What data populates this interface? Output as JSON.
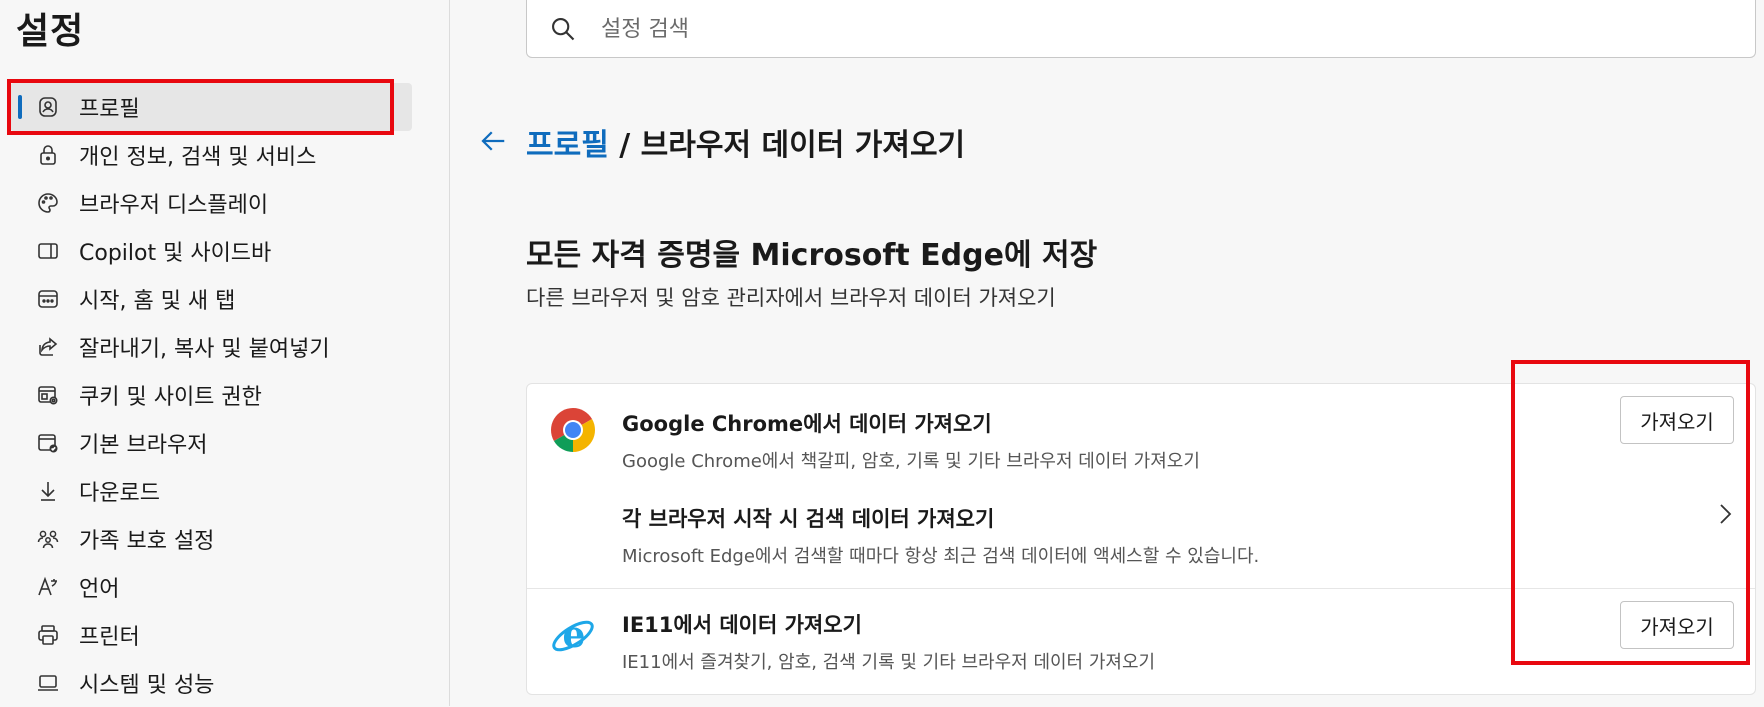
{
  "sidebar": {
    "title": "설정",
    "items": [
      {
        "label": "프로필",
        "icon": "profile-icon"
      },
      {
        "label": "개인 정보, 검색 및 서비스",
        "icon": "lock-icon"
      },
      {
        "label": "브라우저 디스플레이",
        "icon": "palette-icon"
      },
      {
        "label": "Copilot 및 사이드바",
        "icon": "sidebar-icon"
      },
      {
        "label": "시작, 홈 및 새 탭",
        "icon": "new-tab-icon"
      },
      {
        "label": "잘라내기, 복사 및 붙여넣기",
        "icon": "share-icon"
      },
      {
        "label": "쿠키 및 사이트 권한",
        "icon": "site-permissions-icon"
      },
      {
        "label": "기본 브라우저",
        "icon": "default-browser-icon"
      },
      {
        "label": "다운로드",
        "icon": "download-icon"
      },
      {
        "label": "가족 보호 설정",
        "icon": "family-icon"
      },
      {
        "label": "언어",
        "icon": "language-icon"
      },
      {
        "label": "프린터",
        "icon": "printer-icon"
      },
      {
        "label": "시스템 및 성능",
        "icon": "laptop-icon"
      }
    ]
  },
  "search": {
    "placeholder": "설정 검색",
    "value": ""
  },
  "breadcrumb": {
    "parent": "프로필",
    "separator": " / ",
    "current": "브라우저 데이터 가져오기"
  },
  "section": {
    "title": "모든 자격 증명을 Microsoft Edge에 저장",
    "subtitle": "다른 브라우저 및 암호 관리자에서 브라우저 데이터 가져오기"
  },
  "rows": {
    "chrome": {
      "title": "Google Chrome에서 데이터 가져오기",
      "desc": "Google Chrome에서 책갈피, 암호, 기록 및 기타 브라우저 데이터 가져오기",
      "button": "가져오기",
      "icon": "chrome-icon"
    },
    "startup": {
      "title": "각 브라우저 시작 시 검색 데이터 가져오기",
      "desc": "Microsoft Edge에서 검색할 때마다 항상 최근 검색 데이터에 액세스할 수 있습니다."
    },
    "ie11": {
      "title": "IE11에서 데이터 가져오기",
      "desc": "IE11에서 즐겨찾기, 암호, 검색 기록 및 기타 브라우저 데이터 가져오기",
      "button": "가져오기",
      "icon": "ie-icon"
    }
  },
  "colors": {
    "accent": "#0f6cbd",
    "highlight": "#e8080f"
  }
}
